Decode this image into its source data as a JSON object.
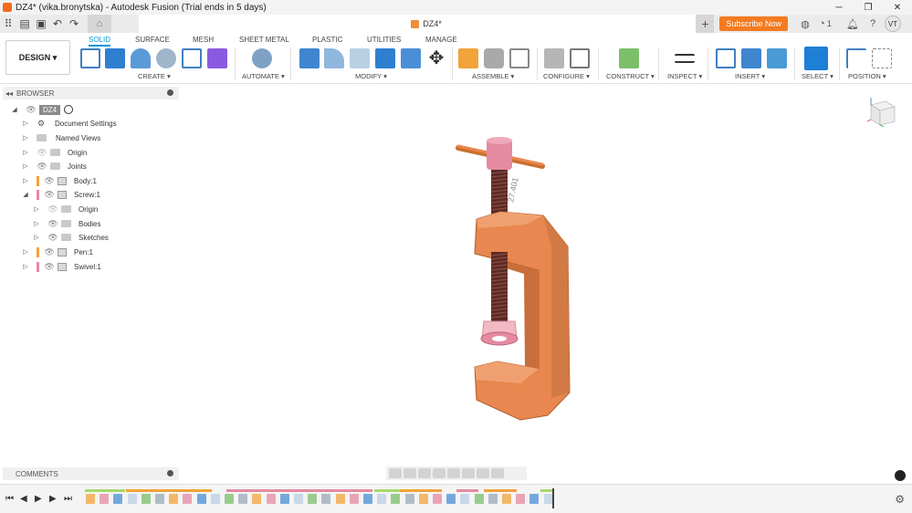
{
  "window": {
    "title": "DZ4* (vika.bronytska) - Autodesk Fusion (Trial ends in 5 days)",
    "minimize": "─",
    "maximize": "❐",
    "close": "✕"
  },
  "document_tab": {
    "name": "DZ4*",
    "close": "✕"
  },
  "header_right": {
    "subscribe": "Subscribe Now",
    "jobs_count": "1",
    "avatar": "VT"
  },
  "ribbon": {
    "workspace": "DESIGN ▾",
    "tabs": [
      "SOLID",
      "SURFACE",
      "MESH",
      "SHEET METAL",
      "PLASTIC",
      "UTILITIES",
      "MANAGE"
    ],
    "groups": [
      "CREATE ▾",
      "AUTOMATE ▾",
      "MODIFY ▾",
      "ASSEMBLE ▾",
      "CONFIGURE ▾",
      "CONSTRUCT ▾",
      "INSPECT ▾",
      "INSERT ▾",
      "SELECT ▾",
      "POSITION ▾"
    ]
  },
  "browser": {
    "title": "BROWSER",
    "items": [
      {
        "label": "DZ4"
      },
      {
        "label": "Document Settings"
      },
      {
        "label": "Named Views"
      },
      {
        "label": "Origin"
      },
      {
        "label": "Joints"
      },
      {
        "label": "Body:1"
      },
      {
        "label": "Screw:1"
      },
      {
        "label": "Origin"
      },
      {
        "label": "Bodies"
      },
      {
        "label": "Sketches"
      },
      {
        "label": "Pen:1"
      },
      {
        "label": "Swivel:1"
      }
    ]
  },
  "comments": {
    "title": "COMMENTS"
  },
  "viewport": {
    "dimension_text": "27.401"
  },
  "colors": {
    "accent": "#0696d7",
    "subscribe": "#f47b20",
    "model_body": "#e8874f",
    "model_pink": "#e58aa0"
  }
}
